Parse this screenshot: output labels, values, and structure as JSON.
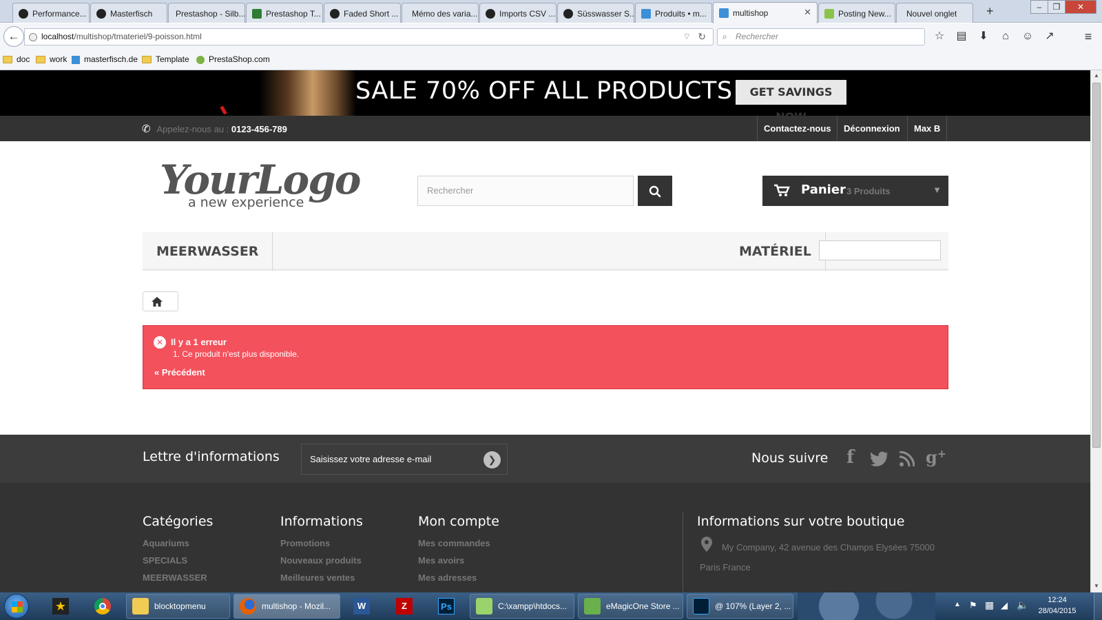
{
  "browser": {
    "tabs": [
      {
        "label": "Performance...",
        "icon": "prestashop-icon"
      },
      {
        "label": "Masterfisch",
        "icon": "prestashop-icon"
      },
      {
        "label": "Prestashop - Silb...",
        "icon": ""
      },
      {
        "label": "Prestashop T...",
        "icon": "puzzle-icon"
      },
      {
        "label": "Faded Short ...",
        "icon": "prestashop-icon"
      },
      {
        "label": "Mémo des varia...",
        "icon": ""
      },
      {
        "label": "Imports CSV ...",
        "icon": "prestashop-icon"
      },
      {
        "label": "Süsswasser S...",
        "icon": "prestashop-icon"
      },
      {
        "label": "Produits • m...",
        "icon": "store-icon"
      },
      {
        "label": "multishop",
        "icon": "store-icon",
        "active": true
      },
      {
        "label": "Posting New...",
        "icon": "forum-icon"
      },
      {
        "label": "Nouvel onglet",
        "icon": ""
      }
    ],
    "url_host": "localhost",
    "url_path": "/multishop/tmateriel/9-poisson.html",
    "search_placeholder": "Rechercher",
    "bookmarks": [
      "doc",
      "work",
      "masterfisch.de",
      "Template",
      "PrestaShop.com"
    ]
  },
  "shop": {
    "banner_text": "SALE 70% OFF ALL PRODUCTS",
    "banner_button": "GET SAVINGS NOW",
    "call_label": "Appelez-nous au :",
    "phone": "0123-456-789",
    "top_links": [
      "Contactez-nous",
      "Déconnexion",
      "Max B"
    ],
    "logo_main": "YourLogo",
    "logo_sub": "a new experience",
    "search_placeholder": "Rechercher",
    "cart_label": "Panier",
    "cart_count": "3 Produits",
    "menu": [
      "MEERWASSER",
      "MATÉRIEL"
    ],
    "error_title": "Il y a 1 erreur",
    "error_item": "1. Ce produit n'est plus disponible.",
    "error_back": "« Précédent",
    "newsletter_title": "Lettre d'informations",
    "newsletter_placeholder": "Saisissez votre adresse e-mail",
    "follow_title": "Nous suivre",
    "footer_cols": [
      {
        "title": "Catégories",
        "links": [
          "Aquariums",
          "SPECIALS",
          "MEERWASSER"
        ]
      },
      {
        "title": "Informations",
        "links": [
          "Promotions",
          "Nouveaux produits",
          "Meilleures ventes"
        ]
      },
      {
        "title": "Mon compte",
        "links": [
          "Mes commandes",
          "Mes avoirs",
          "Mes adresses"
        ]
      }
    ],
    "store_info_title": "Informations sur votre boutique",
    "store_address_1": "My Company, 42 avenue des Champs Elysées 75000",
    "store_address_2": "Paris France",
    "colors": {
      "error": "#f3515c",
      "dark": "#333333",
      "banner": "#000000"
    }
  },
  "taskbar": {
    "buttons": [
      "blocktopmenu",
      "multishop - Mozil...",
      "C:\\xampp\\htdocs...",
      "eMagicOne Store ...",
      "@ 107% (Layer 2, ..."
    ],
    "time": "12:24",
    "date": "28/04/2015"
  }
}
